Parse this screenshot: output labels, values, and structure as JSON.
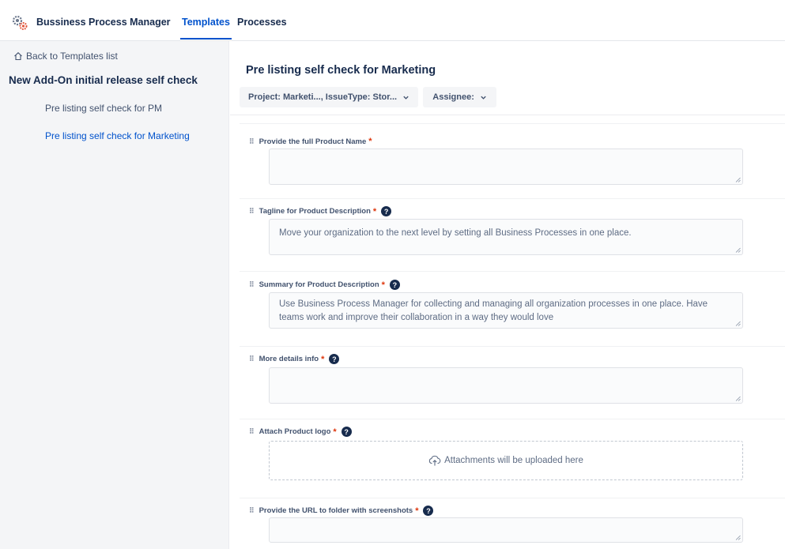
{
  "header": {
    "app_name": "Bussiness Process Manager",
    "tabs": [
      {
        "label": "Templates",
        "active": true
      },
      {
        "label": "Processes",
        "active": false
      }
    ]
  },
  "sidebar": {
    "back_link": "Back to Templates list",
    "template_title": "New Add-On initial release self check",
    "items": [
      {
        "label": "Pre listing self check for PM",
        "active": false
      },
      {
        "label": "Pre listing self check for Marketing",
        "active": true
      }
    ]
  },
  "main": {
    "title": "Pre listing self check for Marketing",
    "filters": {
      "project": "Project: Marketi..., IssueType: Stor...",
      "assignee": "Assignee:"
    },
    "fields": [
      {
        "label": "Provide the full Product Name",
        "required": true,
        "help": false,
        "value": ""
      },
      {
        "label": "Tagline for Product Description",
        "required": true,
        "help": true,
        "value": "Move your organization to the next level by setting all Business Processes in one place."
      },
      {
        "label": "Summary for Product Description",
        "required": true,
        "help": true,
        "value": "Use Business Process Manager for collecting and managing all organization processes in one place. Have teams work and improve their collaboration in a way they would love"
      },
      {
        "label": "More details info",
        "required": true,
        "help": true,
        "value": ""
      },
      {
        "label": "Attach Product logo",
        "required": true,
        "help": true,
        "attachment_text": "Attachments will be uploaded here"
      },
      {
        "label": "Provide the URL to folder with screenshots",
        "required": true,
        "help": true,
        "value": ""
      }
    ],
    "required_mark": "*",
    "help_mark": "?"
  },
  "colors": {
    "accent": "#0052cc",
    "required": "#de350b",
    "text": "#172b4d"
  }
}
